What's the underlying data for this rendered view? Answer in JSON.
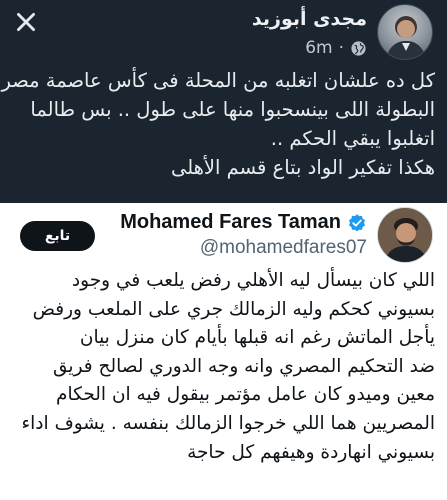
{
  "fb_post": {
    "author_name": "مجدى أبوزيد",
    "time": "6m",
    "privacy_icon": "globe-icon",
    "close_icon": "close-icon",
    "lines": [
      "كل ده علشان اتغلبه من المحلة فى كأس عاصمة مصر",
      "البطولة اللى بينسحبوا منها على طول .. بس طالما",
      "اتغلبوا يبقي الحكم ..",
      "هكذا تفكير الواد بتاع قسم الأهلى"
    ]
  },
  "tweet": {
    "display_name": "Mohamed Fares Taman",
    "handle": "@mohamedfares07",
    "verified_icon": "verified-badge-icon",
    "follow_label": "تابع",
    "lines": [
      "اللي كان بيسأل ليه الأهلي رفض يلعب في وجود",
      "بسيوني كحكم وليه الزمالك جري على الملعب ورفض",
      "يأجل الماتش رغم انه قبلها بأيام كان منزل بيان",
      "ضد التحكيم المصري وانه وجه الدوري لصالح فريق",
      "معين وميدو كان عامل مؤتمر بيقول فيه ان الحكام",
      "المصريين هما اللي خرجوا الزمالك بنفسه . يشوف اداء",
      "بسيوني انهاردة وهيفهم كل حاجة"
    ]
  },
  "colors": {
    "fb_background": "#1b2530",
    "tweet_background": "#ffffff",
    "verified_blue": "#1d9bf0",
    "follow_button": "#0f1419"
  }
}
